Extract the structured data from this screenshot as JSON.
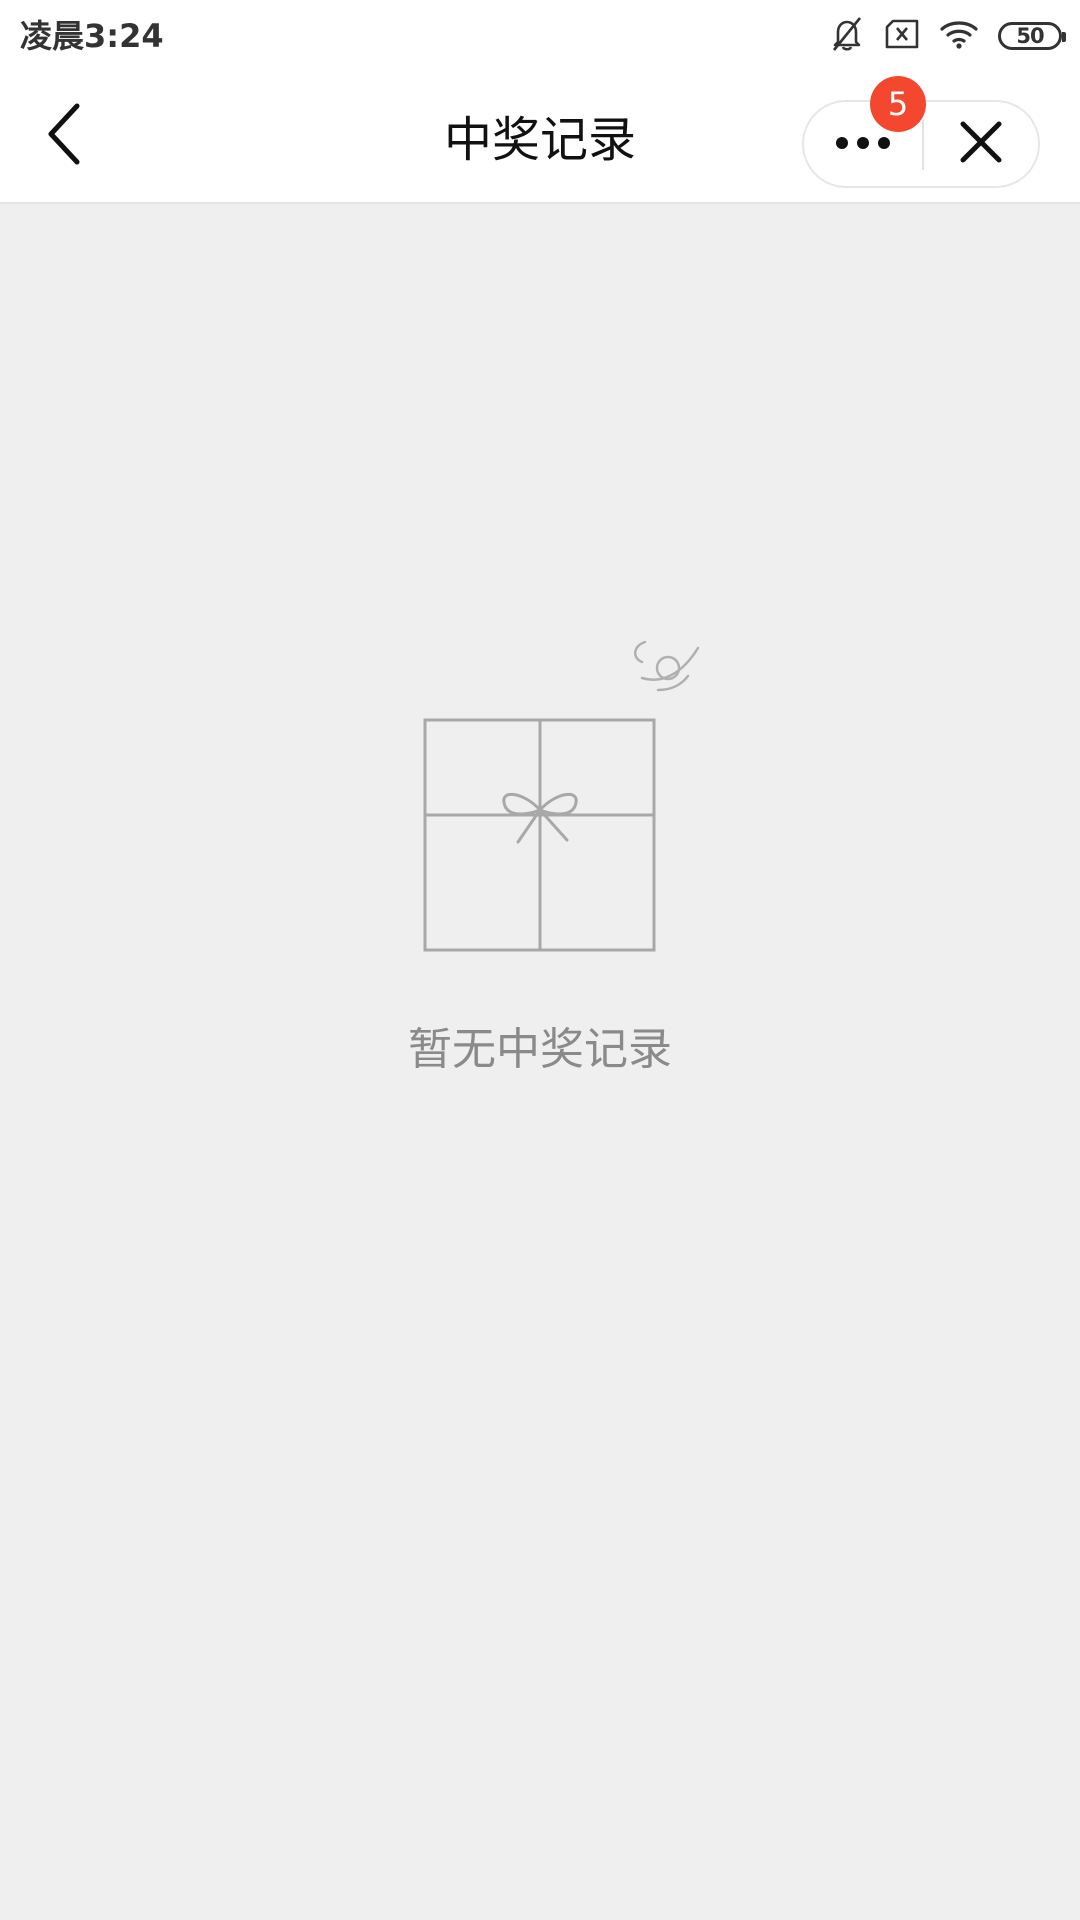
{
  "status_bar": {
    "time": "凌晨3:24",
    "battery_level": "50",
    "icons": [
      "bell-off-icon",
      "sim-x-icon",
      "wifi-icon",
      "battery-icon"
    ]
  },
  "nav_bar": {
    "title": "中奖记录",
    "back_icon": "chevron-left-icon",
    "more_icon": "more-dots-icon",
    "close_icon": "close-icon",
    "badge_count": "5"
  },
  "empty_state": {
    "icon": "gift-box-icon",
    "message": "暂无中奖记录"
  },
  "colors": {
    "background": "#efefef",
    "badge": "#f4472f",
    "icon_gray": "#a8a8a8",
    "text_gray": "#8a8a8a"
  }
}
